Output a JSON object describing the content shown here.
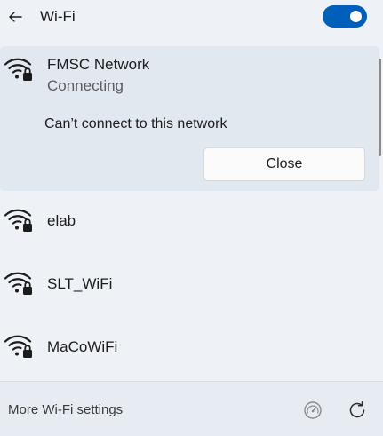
{
  "header": {
    "back_icon": "back-arrow-icon",
    "title": "Wi-Fi",
    "toggle_state": "on",
    "toggle_color": "#005fb8"
  },
  "active_network": {
    "name": "FMSC Network",
    "status": "Connecting",
    "icon": "wifi-secured-icon",
    "message": "Can’t connect to this network",
    "close_label": "Close"
  },
  "networks": [
    {
      "name": "elab",
      "icon": "wifi-secured-icon"
    },
    {
      "name": "SLT_WiFi",
      "icon": "wifi-secured-icon"
    },
    {
      "name": "MaCoWiFi",
      "icon": "wifi-secured-icon"
    }
  ],
  "footer": {
    "settings_link": "More Wi-Fi settings",
    "hotspot_icon": "mobile-hotspot-icon",
    "refresh_icon": "refresh-icon"
  }
}
